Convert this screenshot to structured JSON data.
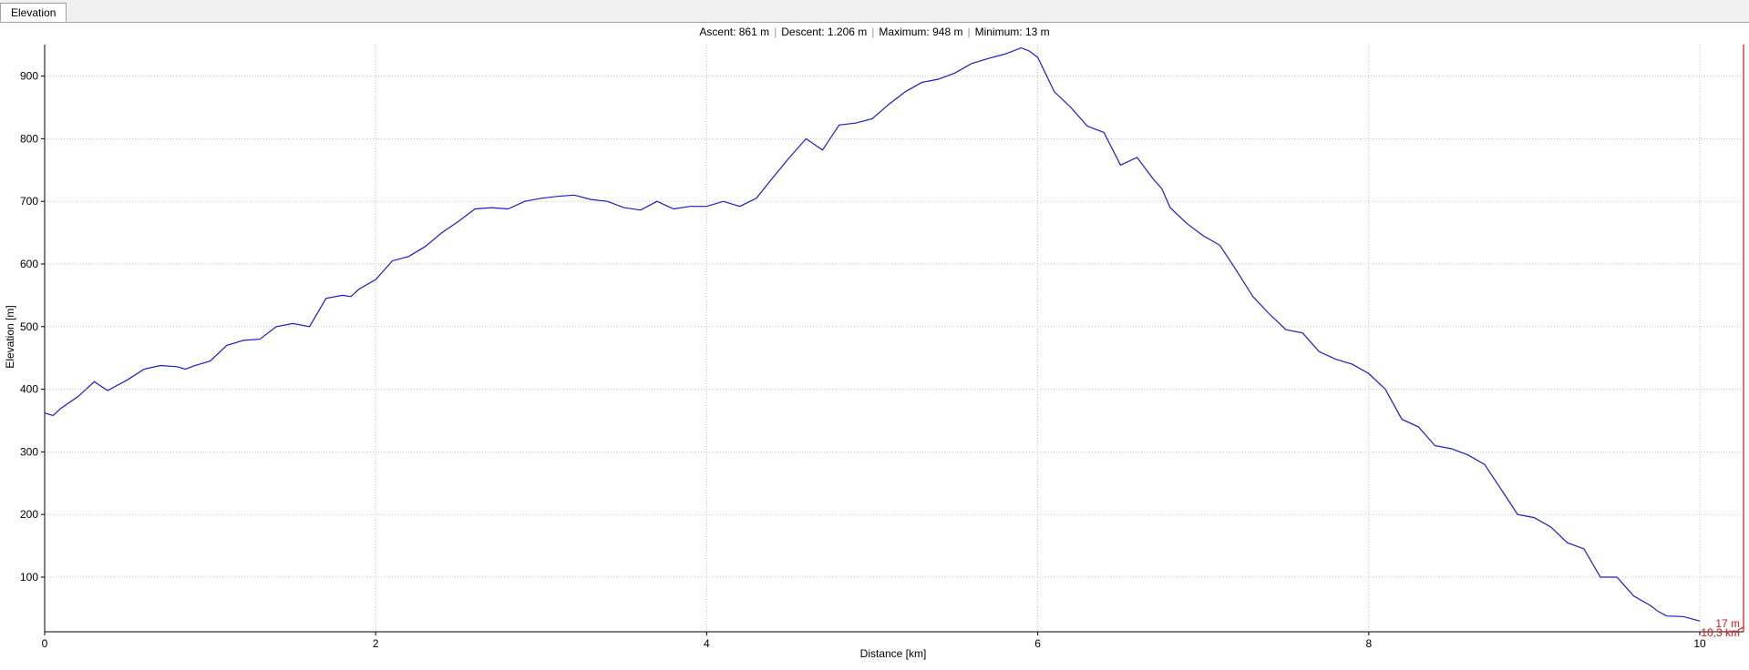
{
  "tab": {
    "label": "Elevation"
  },
  "summary": {
    "ascent": "Ascent: 861 m",
    "descent": "Descent: 1.206 m",
    "maximum": "Maximum: 948 m",
    "minimum": "Minimum: 13 m"
  },
  "colors": {
    "line": "#1a1acc",
    "marker": "#e01010",
    "grid": "#bfbfbf",
    "axis": "#000000"
  },
  "chart_data": {
    "type": "line",
    "xlabel": "Distance [km]",
    "ylabel": "Elevation [m]",
    "xlim": [
      0,
      10.3
    ],
    "ylim": [
      13,
      948
    ],
    "xticks": [
      0,
      2,
      4,
      6,
      8,
      10
    ],
    "yticks": [
      100,
      200,
      300,
      400,
      500,
      600,
      700,
      800,
      900
    ],
    "grid": true,
    "series": [
      {
        "x": [
          0,
          0.05,
          0.1,
          0.2,
          0.3,
          0.38,
          0.5,
          0.6,
          0.7,
          0.8,
          0.85,
          0.9,
          1.0,
          1.1,
          1.2,
          1.3,
          1.4,
          1.5,
          1.6,
          1.7,
          1.8,
          1.85,
          1.9,
          2.0,
          2.1,
          2.2,
          2.3,
          2.4,
          2.5,
          2.6,
          2.7,
          2.8,
          2.9,
          3.0,
          3.1,
          3.2,
          3.3,
          3.4,
          3.5,
          3.6,
          3.7,
          3.8,
          3.9,
          4.0,
          4.1,
          4.2,
          4.3,
          4.4,
          4.5,
          4.6,
          4.7,
          4.8,
          4.9,
          5.0,
          5.1,
          5.2,
          5.3,
          5.4,
          5.5,
          5.6,
          5.7,
          5.8,
          5.9,
          5.95,
          6.0,
          6.1,
          6.2,
          6.3,
          6.4,
          6.5,
          6.6,
          6.7,
          6.75,
          6.8,
          6.9,
          7.0,
          7.1,
          7.2,
          7.3,
          7.4,
          7.5,
          7.6,
          7.7,
          7.8,
          7.9,
          8.0,
          8.1,
          8.2,
          8.3,
          8.4,
          8.5,
          8.6,
          8.7,
          8.8,
          8.9,
          9.0,
          9.1,
          9.2,
          9.3,
          9.4,
          9.5,
          9.6,
          9.7,
          9.75,
          9.8,
          9.9,
          10.0
        ],
        "y": [
          362,
          358,
          370,
          388,
          412,
          398,
          415,
          432,
          438,
          436,
          432,
          437,
          445,
          470,
          478,
          480,
          500,
          505,
          500,
          545,
          550,
          548,
          560,
          575,
          605,
          612,
          628,
          650,
          668,
          688,
          690,
          688,
          700,
          705,
          708,
          710,
          703,
          700,
          690,
          686,
          700,
          688,
          692,
          692,
          700,
          692,
          705,
          738,
          770,
          800,
          782,
          822,
          825,
          832,
          855,
          875,
          890,
          895,
          905,
          920,
          928,
          935,
          945,
          940,
          930,
          875,
          850,
          820,
          810,
          758,
          770,
          735,
          720,
          690,
          665,
          645,
          630,
          590,
          548,
          520,
          495,
          490,
          460,
          448,
          440,
          425,
          400,
          352,
          340,
          310,
          305,
          295,
          280,
          240,
          200,
          195,
          180,
          155,
          145,
          100,
          100,
          70,
          55,
          45,
          38,
          37,
          30
        ]
      }
    ],
    "marker": {
      "x": 10.3,
      "elevation_label": "17 m",
      "distance_label": "10,3 km"
    }
  }
}
